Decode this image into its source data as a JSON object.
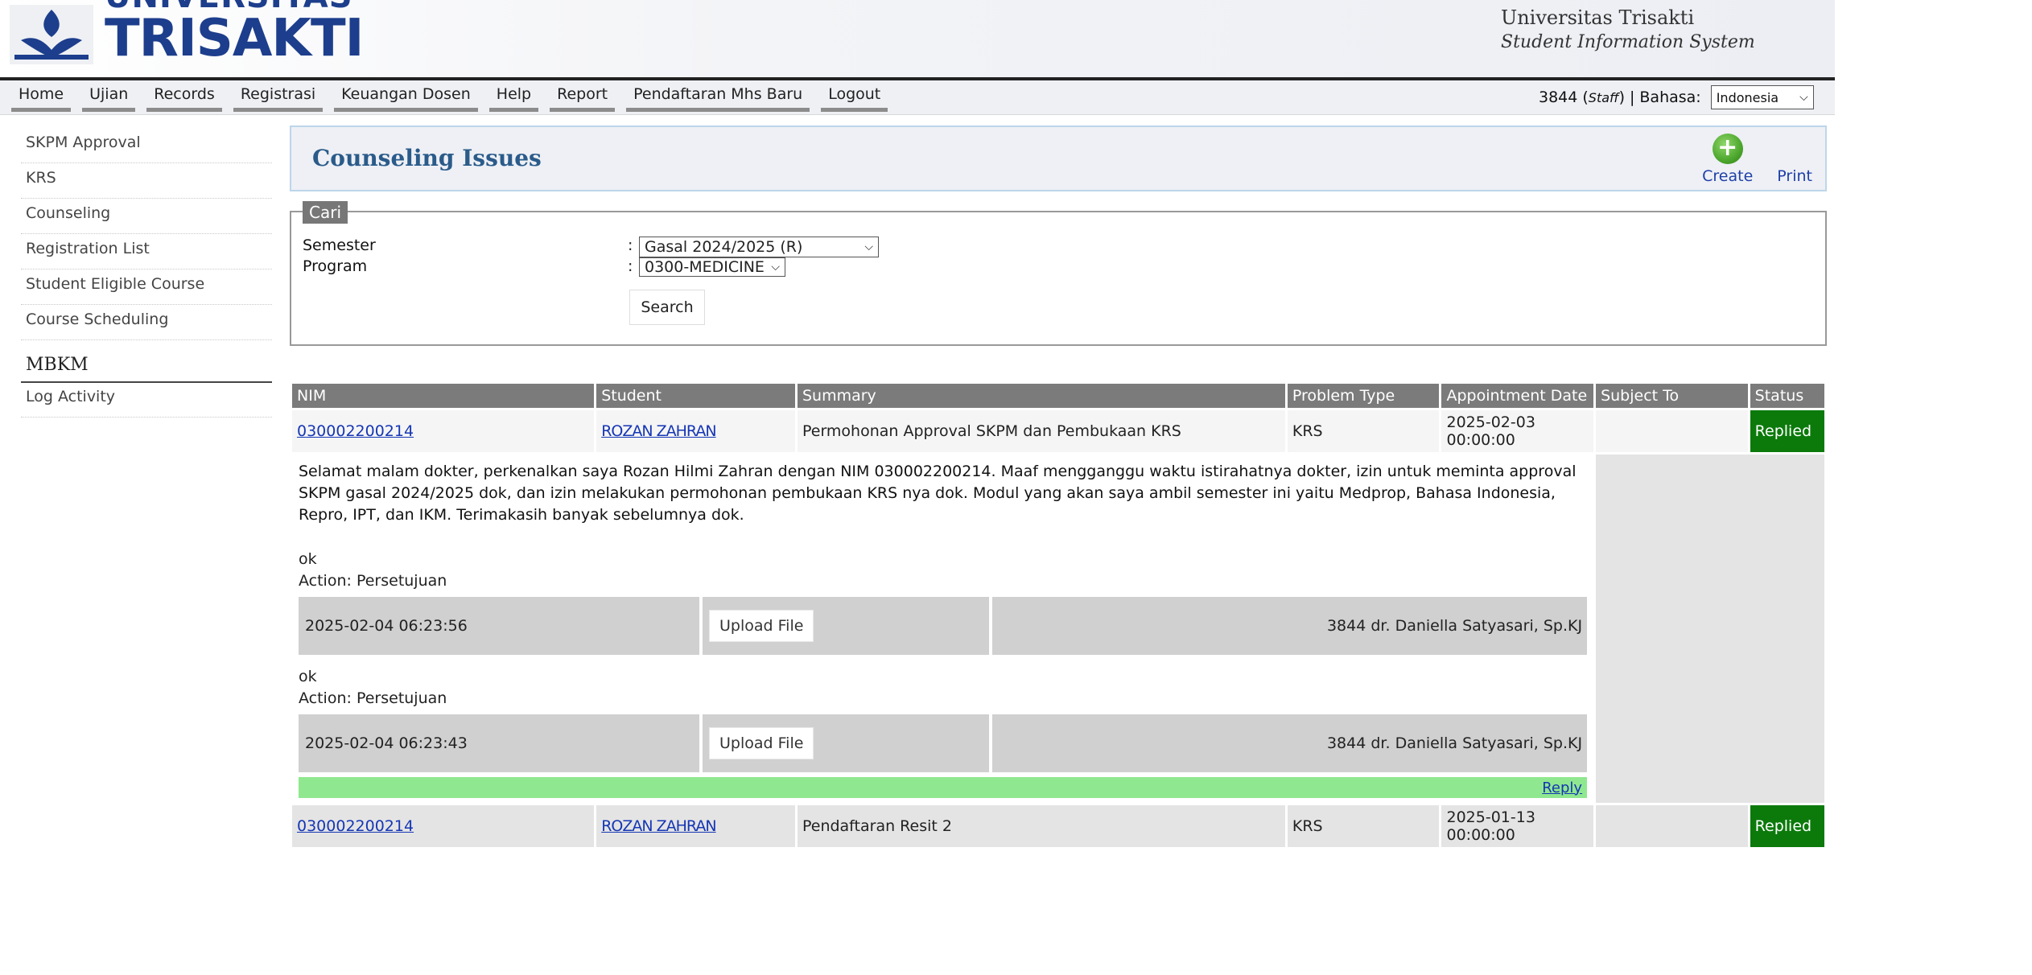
{
  "header": {
    "logo_top": "UNIVERSITAS",
    "logo_bottom": "TRISAKTI",
    "system_name": "Universitas Trisakti",
    "system_subtitle": "Student Information System"
  },
  "menu": [
    {
      "label": "Home"
    },
    {
      "label": "Ujian"
    },
    {
      "label": "Records"
    },
    {
      "label": "Registrasi"
    },
    {
      "label": "Keuangan Dosen"
    },
    {
      "label": "Help"
    },
    {
      "label": "Report"
    },
    {
      "label": "Pendaftaran Mhs Baru"
    },
    {
      "label": "Logout"
    }
  ],
  "user": {
    "id": "3844",
    "role": "Staff",
    "separator": "|",
    "language_label": "Bahasa:",
    "language_value": "Indonesia"
  },
  "sidebar": {
    "items": [
      {
        "label": "SKPM Approval"
      },
      {
        "label": "KRS"
      },
      {
        "label": "Counseling"
      },
      {
        "label": "Registration List"
      },
      {
        "label": "Student Eligible Course"
      },
      {
        "label": "Course Scheduling"
      }
    ],
    "section_heading": "MBKM",
    "section_items": [
      {
        "label": "Log Activity"
      }
    ]
  },
  "page": {
    "title": "Counseling Issues",
    "create_label": "Create",
    "print_label": "Print"
  },
  "search": {
    "legend": "Cari",
    "semester_label": "Semester",
    "semester_value": "Gasal 2024/2025 (R)",
    "program_label": "Program",
    "program_value": "0300-MEDICINE",
    "colon": ":",
    "button_label": "Search"
  },
  "table": {
    "headers": [
      "NIM",
      "Student",
      "Summary",
      "Problem Type",
      "Appointment Date",
      "Subject To",
      "Status"
    ],
    "rows": [
      {
        "nim": "030002200214",
        "student": "ROZAN ZAHRAN",
        "summary": "Permohonan Approval SKPM dan Pembukaan KRS",
        "problem_type": "KRS",
        "appointment_date": "2025-02-03",
        "appointment_time": "00:00:00",
        "subject_to": "",
        "status": "Replied",
        "detail": {
          "message": "Selamat malam dokter, perkenalkan saya Rozan Hilmi Zahran dengan NIM 030002200214. Maaf mengganggu waktu istirahatnya dokter, izin untuk meminta approval SKPM gasal 2024/2025 dok, dan izin melakukan permohonan pembukaan KRS nya dok. Modul yang akan saya ambil semester ini yaitu Medprop, Bahasa Indonesia, Repro, IPT, dan IKM. Terimakasih banyak sebelumnya dok.",
          "replies": [
            {
              "text": "ok",
              "action": "Action: Persetujuan",
              "datetime": "2025-02-04 06:23:56",
              "upload_label": "Upload File",
              "author": "3844 dr. Daniella Satyasari, Sp.KJ"
            },
            {
              "text": "ok",
              "action": "Action: Persetujuan",
              "datetime": "2025-02-04 06:23:43",
              "upload_label": "Upload File",
              "author": "3844 dr. Daniella Satyasari, Sp.KJ"
            }
          ],
          "reply_link": "Reply"
        }
      },
      {
        "nim": "030002200214",
        "student": "ROZAN ZAHRAN",
        "summary": "Pendaftaran Resit 2",
        "problem_type": "KRS",
        "appointment_date": "2025-01-13",
        "appointment_time": "00:00:00",
        "subject_to": "",
        "status": "Replied"
      }
    ]
  },
  "colors": {
    "status_replied": "#0b7a0b",
    "reply_bar": "#8fe88f",
    "header_row": "#7b7b7b",
    "title_color": "#2a5b8a",
    "link": "#1536b5"
  }
}
